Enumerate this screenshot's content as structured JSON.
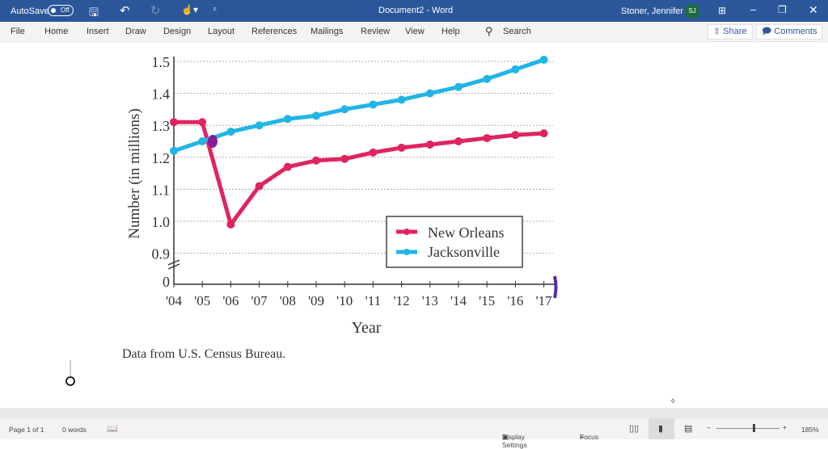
{
  "titlebar": {
    "autosave_label": "AutoSave",
    "autosave_state": "Off",
    "document_title": "Document2 - Word",
    "user_name": "Stoner, Jennifer L",
    "user_initials": "SJ"
  },
  "ribbon": {
    "tabs": [
      "File",
      "Home",
      "Insert",
      "Draw",
      "Design",
      "Layout",
      "References",
      "Mailings",
      "Review",
      "View",
      "Help"
    ],
    "search_label": "Search",
    "share_label": "Share",
    "comments_label": "Comments"
  },
  "chart_data": {
    "type": "line",
    "xlabel": "Year",
    "ylabel": "Number (in millions)",
    "categories": [
      "'04",
      "'05",
      "'06",
      "'07",
      "'08",
      "'09",
      "'10",
      "'11",
      "'12",
      "'13",
      "'14",
      "'15",
      "'16",
      "'17"
    ],
    "yticks": [
      "0",
      "0.9",
      "1.0",
      "1.1",
      "1.2",
      "1.3",
      "1.4",
      "1.5"
    ],
    "ylim": [
      0.9,
      1.5
    ],
    "axis_break": true,
    "grid": true,
    "legend_position": "lower-right",
    "series": [
      {
        "name": "New Orleans",
        "color": "#e0245e",
        "values": [
          1.31,
          1.31,
          0.99,
          1.11,
          1.17,
          1.19,
          1.195,
          1.215,
          1.23,
          1.24,
          1.25,
          1.26,
          1.27,
          1.275
        ]
      },
      {
        "name": "Jacksonville",
        "color": "#21b5e6",
        "values": [
          1.22,
          1.25,
          1.28,
          1.3,
          1.32,
          1.33,
          1.35,
          1.365,
          1.38,
          1.4,
          1.42,
          1.445,
          1.475,
          1.505
        ]
      }
    ],
    "source": "Data from U.S. Census Bureau."
  },
  "status": {
    "page": "Page 1 of 1",
    "words": "0 words",
    "display_settings": "Display Settings",
    "focus": "Focus",
    "zoom": "185%",
    "zoom_level_percent": 185
  }
}
